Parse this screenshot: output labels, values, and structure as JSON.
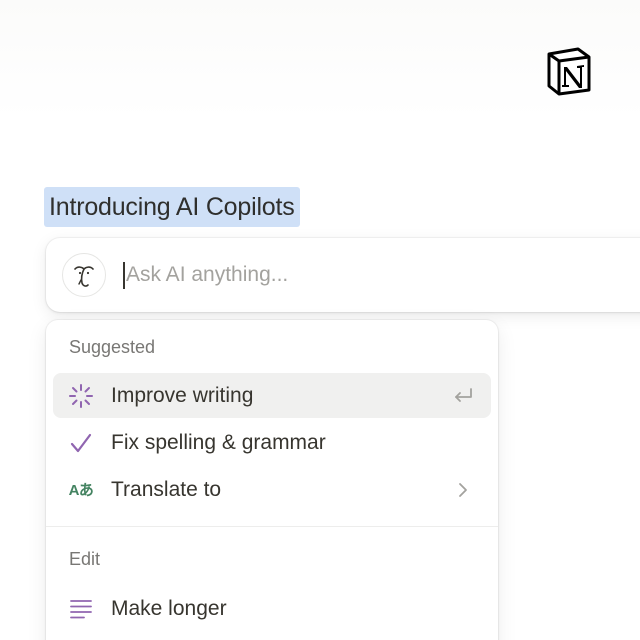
{
  "brand": {
    "logo_icon": "notion-logo-icon"
  },
  "document": {
    "heading": "Introducing AI Copilots",
    "selection_color": "#cfe0f7"
  },
  "ask_bar": {
    "placeholder": "Ask AI anything...",
    "avatar_icon": "ai-face-icon"
  },
  "menu": {
    "sections": [
      {
        "label": "Suggested",
        "items": [
          {
            "label": "Improve writing",
            "icon": "sparkle-icon",
            "trailing_icon": "enter-return-icon",
            "active": true
          },
          {
            "label": "Fix spelling & grammar",
            "icon": "checkmark-icon"
          },
          {
            "label": "Translate to",
            "icon": "translate-icon",
            "icon_text": "Aあ",
            "trailing_icon": "chevron-right-icon"
          }
        ]
      },
      {
        "label": "Edit",
        "items": [
          {
            "label": "Make longer",
            "icon": "lines-icon"
          }
        ]
      }
    ]
  },
  "colors": {
    "accent_purple": "#9065b0",
    "translate_green": "#448361",
    "text": "#37352f",
    "muted_text": "#787774",
    "hover_bg": "#f0f0ef"
  }
}
